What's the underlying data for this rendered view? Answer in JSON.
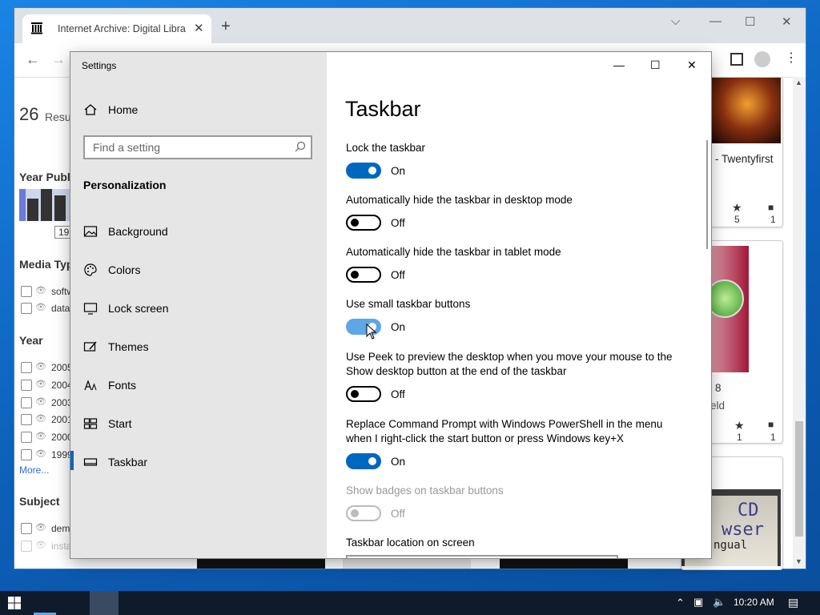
{
  "browser": {
    "tab_title": "Internet Archive: Digital Library of Free & Borrowable Books",
    "new_tab": "+",
    "tab_close": "✕",
    "window_controls": {
      "dropdown": "⌵",
      "minimize": "—",
      "maximize": "☐",
      "close": "✕"
    }
  },
  "web": {
    "results_count": "26",
    "results_label": "Resu",
    "year_published": "Year Publ",
    "year_hist_box": "19",
    "media_type": "Media Typ",
    "media_items": [
      "softw",
      "data"
    ],
    "year": "Year",
    "year_items": [
      "2005",
      "2004",
      "2003",
      "2001",
      "2000",
      "1999"
    ],
    "more": "More...",
    "subject": "Subject",
    "subject_items": [
      "dem",
      "insta"
    ],
    "card1_title": "- Twentyfirst",
    "card1_stars": "5",
    "card1_comments": "1",
    "card2_title": "8",
    "card2_sub": "eld",
    "card2_stars": "1",
    "card2_comments": "1",
    "card3_image_text_1": "CD",
    "card3_image_text_2": "wser",
    "card3_image_text_3": "ngual"
  },
  "settings": {
    "window_title": "Settings",
    "controls": {
      "minimize": "—",
      "maximize": "☐",
      "close": "✕"
    },
    "home": "Home",
    "search_placeholder": "Find a setting",
    "section": "Personalization",
    "nav": [
      "Background",
      "Colors",
      "Lock screen",
      "Themes",
      "Fonts",
      "Start",
      "Taskbar"
    ],
    "selected": "Taskbar",
    "page_title": "Taskbar",
    "options": [
      {
        "label": "Lock the taskbar",
        "state": "On"
      },
      {
        "label": "Automatically hide the taskbar in desktop mode",
        "state": "Off"
      },
      {
        "label": "Automatically hide the taskbar in tablet mode",
        "state": "Off"
      },
      {
        "label": "Use small taskbar buttons",
        "state": "On"
      },
      {
        "label": "Use Peek to preview the desktop when you move your mouse to the",
        "label2": "Show desktop button at the end of the taskbar",
        "state": "Off"
      },
      {
        "label": "Replace Command Prompt with Windows PowerShell in the menu",
        "label2": "when I right-click the start button or press Windows key+X",
        "state": "On"
      },
      {
        "label": "Show badges on taskbar buttons",
        "state": "Off"
      }
    ],
    "location_label": "Taskbar location on screen"
  },
  "taskbar": {
    "time": "10:20 AM"
  }
}
